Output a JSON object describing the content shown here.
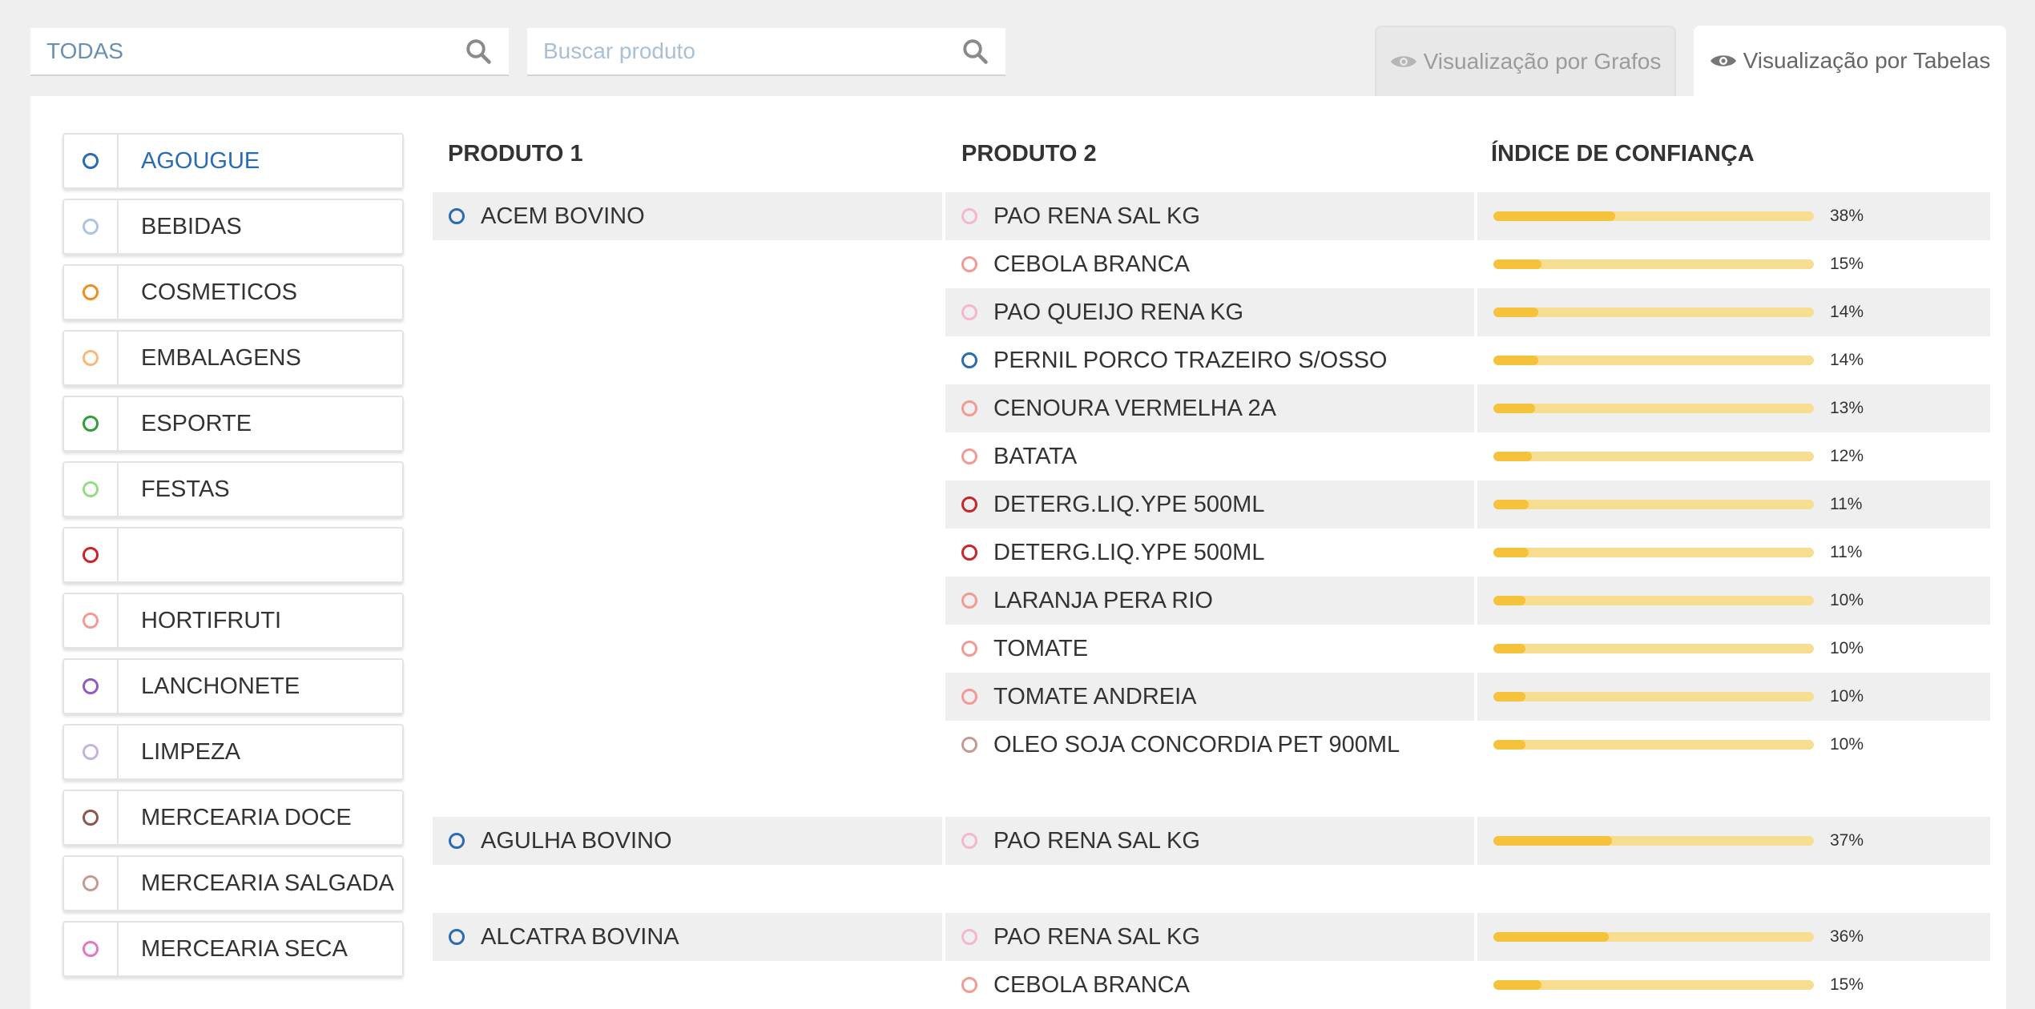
{
  "search": {
    "category_value": "TODAS",
    "product_placeholder": "Buscar produto"
  },
  "tabs": {
    "graph_label": "Visualização por Grafos",
    "table_label": "Visualização por Tabelas"
  },
  "headers": {
    "produto1": "PRODUTO 1",
    "produto2": "PRODUTO 2",
    "confianca": "ÍNDICE DE CONFIANÇA"
  },
  "categories": [
    {
      "label": "AGOUGUE",
      "color": "#2a6bb1",
      "active": true
    },
    {
      "label": "BEBIDAS",
      "color": "#a9c4e6"
    },
    {
      "label": "COSMETICOS",
      "color": "#f28c1e"
    },
    {
      "label": "EMBALAGENS",
      "color": "#f7b87a"
    },
    {
      "label": "ESPORTE",
      "color": "#2e9e3a"
    },
    {
      "label": "FESTAS",
      "color": "#93dd84"
    },
    {
      "label": "",
      "color": "#d11f25"
    },
    {
      "label": "HORTIFRUTI",
      "color": "#f29a93"
    },
    {
      "label": "LANCHONETE",
      "color": "#9359c2"
    },
    {
      "label": "LIMPEZA",
      "color": "#c5b2dd"
    },
    {
      "label": "MERCEARIA DOCE",
      "color": "#8c564b"
    },
    {
      "label": "MERCEARIA SALGADA",
      "color": "#c49a92"
    },
    {
      "label": "MERCEARIA SECA",
      "color": "#e377c2"
    }
  ],
  "groups": [
    {
      "produto1": {
        "name": "ACEM BOVINO",
        "color": "#2a6bb1"
      },
      "items": [
        {
          "name": "PAO RENA SAL KG",
          "color": "#f4b6d2",
          "pct": 38,
          "label": "38%"
        },
        {
          "name": "CEBOLA BRANCA",
          "color": "#f29a93",
          "pct": 15,
          "label": "15%"
        },
        {
          "name": "PAO QUEIJO RENA KG",
          "color": "#f4b6d2",
          "pct": 14,
          "label": "14%"
        },
        {
          "name": "PERNIL PORCO TRAZEIRO S/OSSO",
          "color": "#2a6bb1",
          "pct": 14,
          "label": "14%"
        },
        {
          "name": "CENOURA VERMELHA 2A",
          "color": "#f29a93",
          "pct": 13,
          "label": "13%"
        },
        {
          "name": "BATATA",
          "color": "#f29a93",
          "pct": 12,
          "label": "12%"
        },
        {
          "name": "DETERG.LIQ.YPE 500ML",
          "color": "#c62828",
          "pct": 11,
          "label": "11%"
        },
        {
          "name": "DETERG.LIQ.YPE 500ML",
          "color": "#c62828",
          "pct": 11,
          "label": "11%"
        },
        {
          "name": "LARANJA PERA RIO",
          "color": "#f29a93",
          "pct": 10,
          "label": "10%"
        },
        {
          "name": "TOMATE",
          "color": "#f29a93",
          "pct": 10,
          "label": "10%"
        },
        {
          "name": "TOMATE ANDREIA",
          "color": "#f29a93",
          "pct": 10,
          "label": "10%"
        },
        {
          "name": "OLEO SOJA CONCORDIA PET 900ML",
          "color": "#c49a92",
          "pct": 10,
          "label": "10%"
        }
      ]
    },
    {
      "produto1": {
        "name": "AGULHA BOVINO",
        "color": "#2a6bb1"
      },
      "items": [
        {
          "name": "PAO RENA SAL KG",
          "color": "#f4b6d2",
          "pct": 37,
          "label": "37%"
        }
      ]
    },
    {
      "produto1": {
        "name": "ALCATRA BOVINA",
        "color": "#2a6bb1"
      },
      "items": [
        {
          "name": "PAO RENA SAL KG",
          "color": "#f4b6d2",
          "pct": 36,
          "label": "36%"
        },
        {
          "name": "CEBOLA BRANCA",
          "color": "#f29a93",
          "pct": 15,
          "label": "15%"
        }
      ]
    }
  ]
}
